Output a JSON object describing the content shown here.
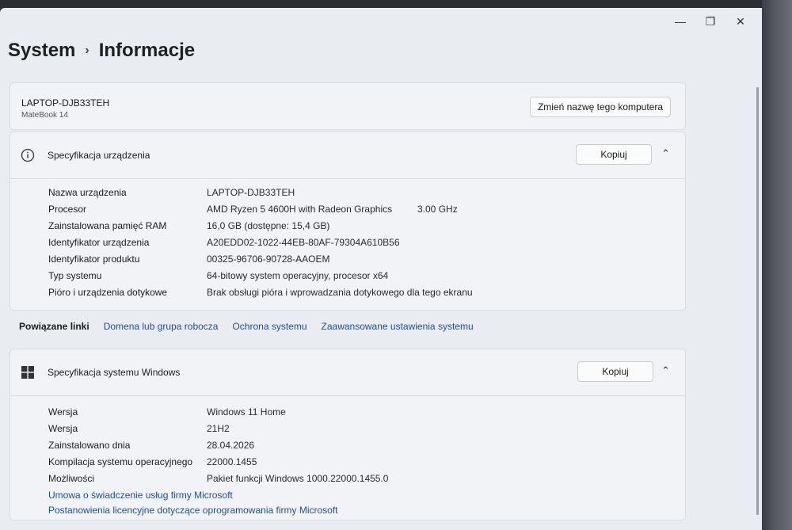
{
  "window": {
    "controls": {
      "minimize": "—",
      "maximize": "❐",
      "close": "✕"
    }
  },
  "breadcrumb": {
    "parent": "System",
    "separator": "›",
    "current": "Informacje"
  },
  "pc": {
    "name": "LAPTOP-DJB33TEH",
    "model": "MateBook 14",
    "rename_button": "Zmień nazwę tego komputera"
  },
  "device_spec": {
    "title": "Specyfikacja urządzenia",
    "copy_button": "Kopiuj",
    "rows": [
      {
        "label": "Nazwa urządzenia",
        "value": "LAPTOP-DJB33TEH"
      },
      {
        "label": "Procesor",
        "value": "AMD Ryzen 5 4600H with Radeon Graphics",
        "extra": "3.00 GHz"
      },
      {
        "label": "Zainstalowana pamięć RAM",
        "value": "16,0 GB (dostępne: 15,4 GB)"
      },
      {
        "label": "Identyfikator urządzenia",
        "value": "A20EDD02-1022-44EB-80AF-79304A610B56"
      },
      {
        "label": "Identyfikator produktu",
        "value": "00325-96706-90728-AAOEM"
      },
      {
        "label": "Typ systemu",
        "value": "64-bitowy system operacyjny, procesor x64"
      },
      {
        "label": "Pióro i urządzenia dotykowe",
        "value": "Brak obsługi pióra i wprowadzania dotykowego dla tego ekranu"
      }
    ]
  },
  "related_links": {
    "label": "Powiązane linki",
    "items": [
      "Domena lub grupa robocza",
      "Ochrona systemu",
      "Zaawansowane ustawienia systemu"
    ]
  },
  "windows_spec": {
    "title": "Specyfikacja systemu Windows",
    "copy_button": "Kopiuj",
    "rows": [
      {
        "label": "Wersja",
        "value": "Windows 11 Home"
      },
      {
        "label": "Wersja",
        "value": "21H2"
      },
      {
        "label": "Zainstalowano dnia",
        "value": "28.04.2026"
      },
      {
        "label": "Kompilacja systemu operacyjnego",
        "value": "22000.1455"
      },
      {
        "label": "Możliwości",
        "value": "Pakiet funkcji Windows 1000.22000.1455.0"
      }
    ],
    "links": [
      "Umowa o świadczenie usług firmy Microsoft",
      "Postanowienia licencyjne dotyczące oprogramowania firmy Microsoft"
    ]
  }
}
